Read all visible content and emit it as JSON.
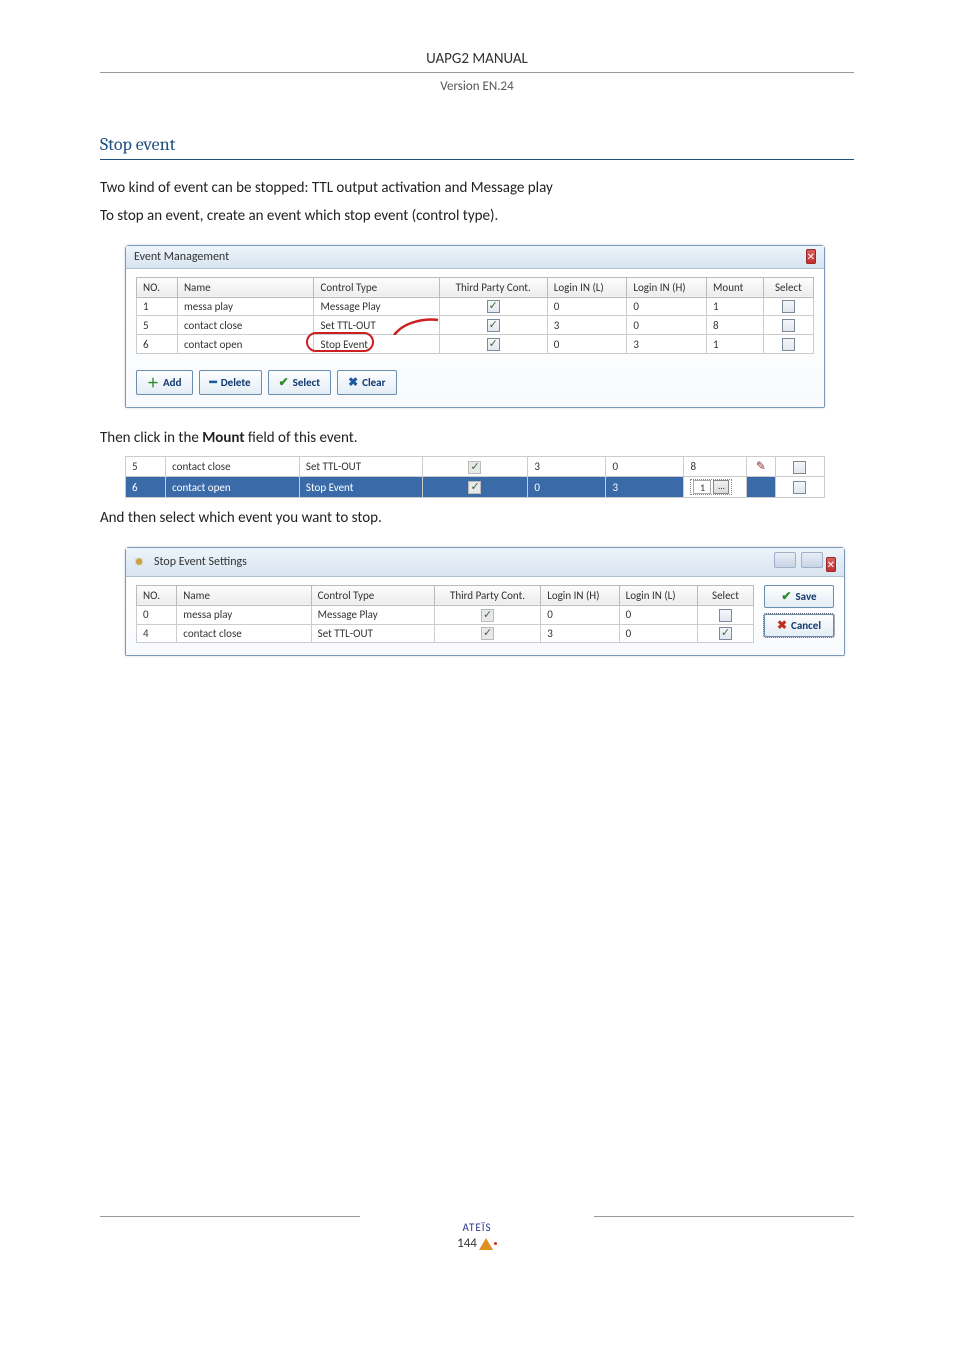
{
  "header": {
    "title": "UAPG2  MANUAL",
    "version": "Version EN.24"
  },
  "section": {
    "title": "Stop event",
    "p1": "Two kind of event can be stopped: TTL output activation and Message play",
    "p2": "To stop an event, create an event which stop event (control type).",
    "p3a": "Then click in the ",
    "p3b": "Mount",
    "p3c": " field of this event.",
    "p4": "And then select which event you want to stop."
  },
  "eventMgmt": {
    "title": "Event Management",
    "headers": [
      "NO.",
      "Name",
      "Control Type",
      "Third Party Cont.",
      "Login IN (L)",
      "Login IN (H)",
      "Mount",
      "Select"
    ],
    "rows": [
      {
        "no": "1",
        "name": "messa play",
        "ctype": "Message Play",
        "third": true,
        "l": "0",
        "h": "0",
        "mount": "1",
        "select": false
      },
      {
        "no": "5",
        "name": "contact close",
        "ctype": "Set TTL-OUT",
        "third": true,
        "l": "3",
        "h": "0",
        "mount": "8",
        "select": false
      },
      {
        "no": "6",
        "name": "contact open",
        "ctype": "Stop Event",
        "third": true,
        "l": "0",
        "h": "3",
        "mount": "1",
        "select": false
      }
    ],
    "buttons": {
      "add": "Add",
      "delete": "Delete",
      "select": "Select",
      "clear": "Clear"
    }
  },
  "mountRows": {
    "r1": {
      "no": "5",
      "name": "contact close",
      "ctype": "Set TTL-OUT",
      "l": "3",
      "h": "0",
      "mount": "8"
    },
    "r2": {
      "no": "6",
      "name": "contact open",
      "ctype": "Stop Event",
      "l": "0",
      "h": "3",
      "mount": "1"
    }
  },
  "stopSettings": {
    "title": "Stop Event Settings",
    "headers": [
      "NO.",
      "Name",
      "Control Type",
      "Third Party Cont.",
      "Login IN (H)",
      "Login IN (L)",
      "Select"
    ],
    "rows": [
      {
        "no": "0",
        "name": "messa play",
        "ctype": "Message Play",
        "thirdDisabled": true,
        "h": "0",
        "l": "0",
        "select": false
      },
      {
        "no": "4",
        "name": "contact close",
        "ctype": "Set TTL-OUT",
        "thirdDisabled": true,
        "h": "3",
        "l": "0",
        "select": true
      }
    ],
    "buttons": {
      "save": "Save",
      "cancel": "Cancel"
    }
  },
  "footer": {
    "brand": "ATEÏS",
    "page": "144"
  }
}
